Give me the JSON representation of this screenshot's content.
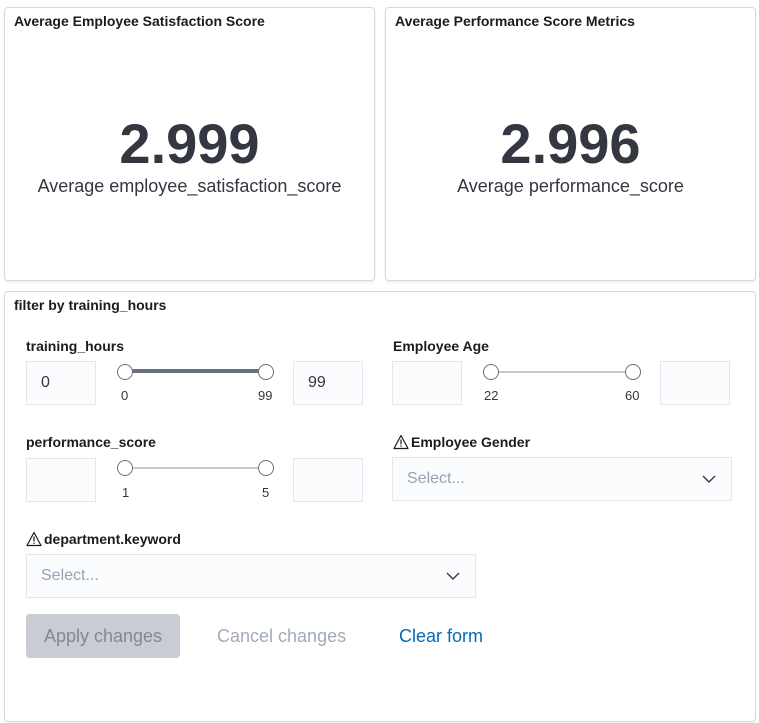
{
  "metrics": [
    {
      "title": "Average Employee Satisfaction Score",
      "value": "2.999",
      "label": "Average employee_satisfaction_score"
    },
    {
      "title": "Average Performance Score Metrics",
      "value": "2.996",
      "label": "Average performance_score"
    }
  ],
  "filter": {
    "title": "filter by training_hours",
    "training_hours": {
      "label": "training_hours",
      "min_value": "0",
      "max_value": "99",
      "tick_min": "0",
      "tick_max": "99"
    },
    "employee_age": {
      "label": "Employee Age",
      "min_value": "",
      "max_value": "",
      "tick_min": "22",
      "tick_max": "60"
    },
    "performance_score": {
      "label": "performance_score",
      "min_value": "",
      "max_value": "",
      "tick_min": "1",
      "tick_max": "5"
    },
    "employee_gender": {
      "label": "Employee Gender",
      "placeholder": "Select...",
      "warning_icon": "warning-icon"
    },
    "department": {
      "label": "department.keyword",
      "placeholder": "Select...",
      "warning_icon": "warning-icon"
    },
    "buttons": {
      "apply": "Apply changes",
      "cancel": "Cancel changes",
      "clear": "Clear form"
    }
  },
  "colors": {
    "link": "#006bb8",
    "disabled_text": "#a2abba",
    "slider_active": "#69707d"
  }
}
